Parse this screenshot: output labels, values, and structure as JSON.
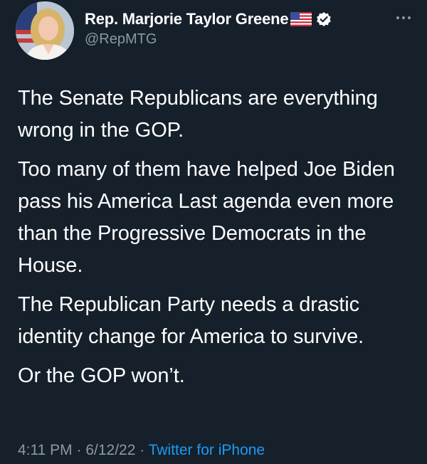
{
  "author": {
    "name": "Rep. Marjorie Taylor Greene",
    "flag": "🇺🇸",
    "handle": "@RepMTG"
  },
  "tweet": {
    "paragraphs": [
      "The Senate Republicans are everything wrong in the GOP.",
      "Too many of them have helped Joe Biden pass his America Last agenda even more than the Progressive Democrats in the House.",
      "The Republican Party needs a drastic identity change for America to survive.",
      "Or the GOP won’t."
    ]
  },
  "meta": {
    "time": "4:11 PM",
    "separator": " · ",
    "date": "6/12/22",
    "source": "Twitter for iPhone"
  },
  "colors": {
    "background": "#15202b",
    "text": "#ffffff",
    "secondary": "#8b98a5",
    "link": "#1d9bf0"
  },
  "icons": {
    "verified": "verified-badge-icon",
    "more": "more-options-icon",
    "flag": "us-flag-icon"
  }
}
